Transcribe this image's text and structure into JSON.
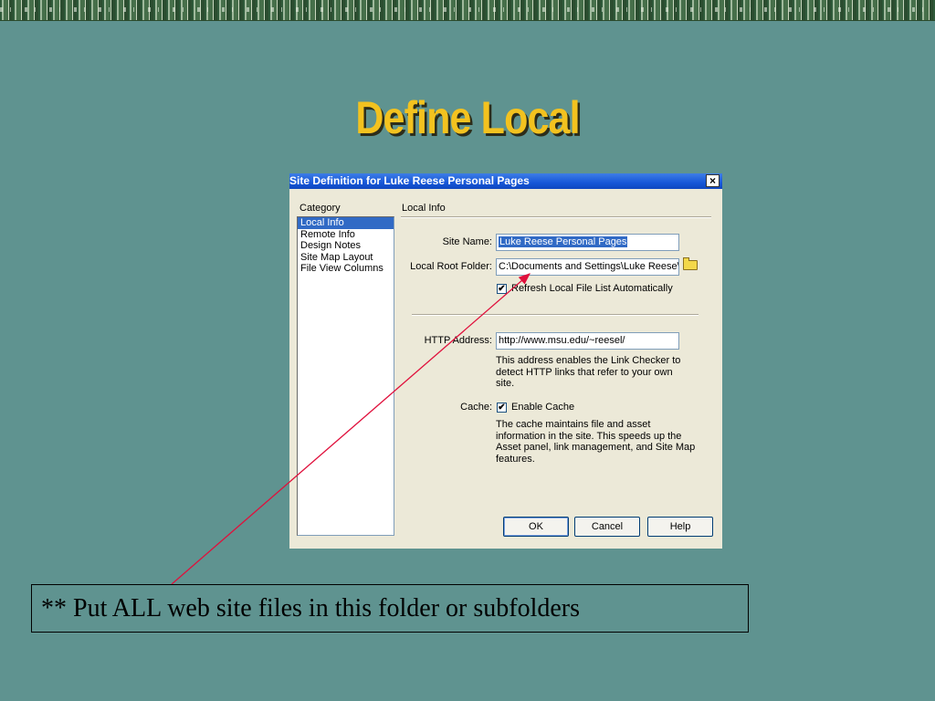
{
  "slide": {
    "title": "Define Local",
    "annotation": "** Put ALL web site files in this folder or subfolders"
  },
  "dialog": {
    "title": "Site Definition for Luke Reese Personal Pages",
    "category_label": "Category",
    "categories": [
      "Local Info",
      "Remote Info",
      "Design Notes",
      "Site Map Layout",
      "File View Columns"
    ],
    "selected_category": "Local Info",
    "section_label": "Local Info",
    "site_name": {
      "label": "Site Name:",
      "value": "Luke Reese Personal Pages"
    },
    "local_root_folder": {
      "label": "Local Root Folder:",
      "value": "C:\\Documents and Settings\\Luke Reese\\"
    },
    "refresh_checkbox": {
      "label": "Refresh Local File List Automatically",
      "checked": true
    },
    "http_address": {
      "label": "HTTP Address:",
      "value": "http://www.msu.edu/~reesel/",
      "note_lines": [
        "This address enables the Link Checker to",
        "detect HTTP links that refer to your own",
        "site."
      ]
    },
    "cache": {
      "label": "Cache:",
      "checkbox_label": "Enable Cache",
      "checked": true,
      "note_lines": [
        "The cache maintains file and asset",
        "information in the site.  This speeds up the",
        "Asset panel, link management, and Site Map",
        "features."
      ]
    },
    "buttons": {
      "ok": "OK",
      "cancel": "Cancel",
      "help": "Help"
    },
    "close_glyph": "×"
  },
  "colors": {
    "slide_background": "#5f9390",
    "title_gold": "#f3c21f",
    "titlebar_blue": "#1757d8",
    "selection_blue": "#316ac5",
    "arrow_red": "#e0103c"
  },
  "icons": {
    "folder": "folder-icon",
    "check": "✔"
  }
}
